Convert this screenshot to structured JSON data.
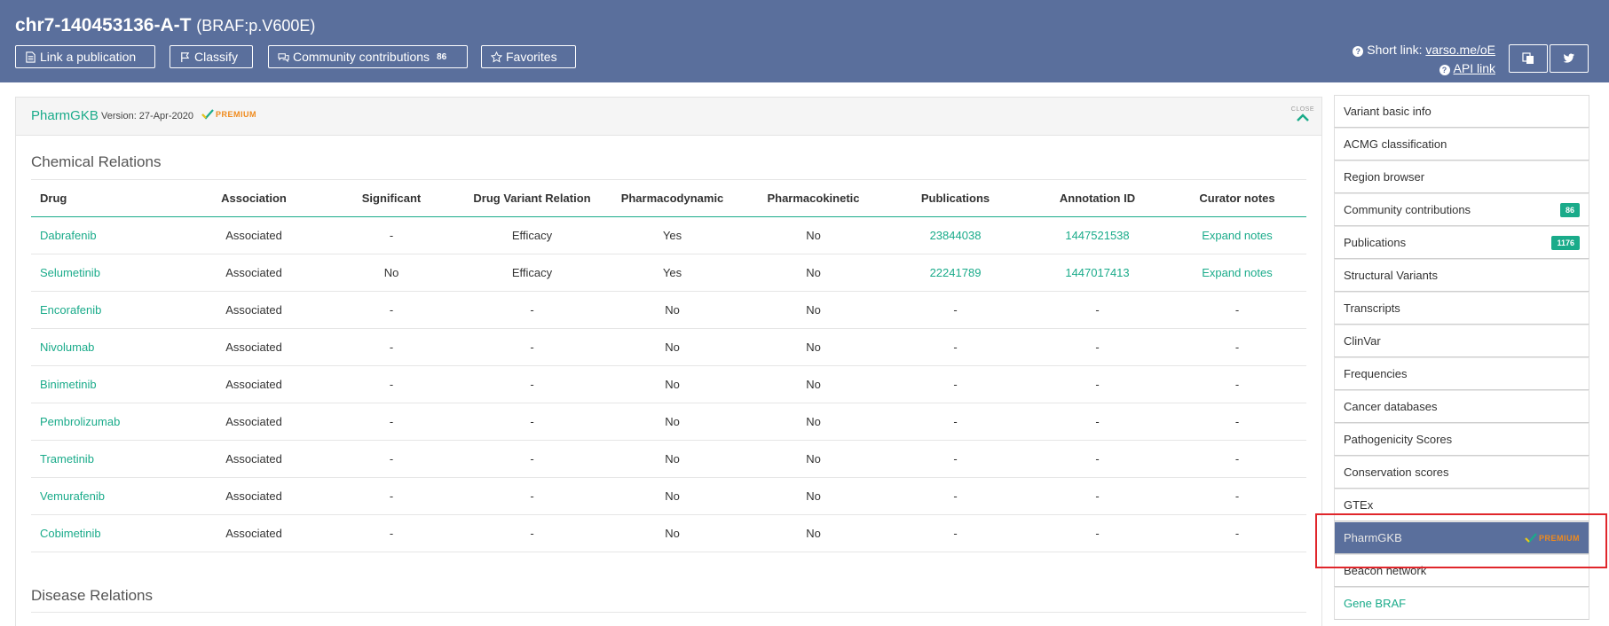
{
  "header": {
    "variant": "chr7-140453136-A-T",
    "protein": "(BRAF:p.V600E)",
    "buttons": {
      "link_publication": "Link a publication",
      "classify": "Classify",
      "community": "Community contributions",
      "community_count": "86",
      "favorites": "Favorites"
    },
    "short_link_label": "Short link:",
    "short_link_value": "varso.me/oE",
    "api_link": "API link",
    "icons": [
      "document-icon",
      "flag-icon",
      "comments-icon",
      "star-icon",
      "question-icon",
      "copy-icon",
      "twitter-icon"
    ]
  },
  "panel": {
    "title": "PharmGKB",
    "version": "Version: 27-Apr-2020",
    "premium": "PREMIUM",
    "close": "CLOSE",
    "chemical_relations_title": "Chemical Relations",
    "disease_relations_title": "Disease Relations",
    "columns": [
      "Drug",
      "Association",
      "Significant",
      "Drug Variant Relation",
      "Pharmacodynamic",
      "Pharmacokinetic",
      "Publications",
      "Annotation ID",
      "Curator notes"
    ],
    "rows": [
      [
        "Dabrafenib",
        "Associated",
        "-",
        "Efficacy",
        "Yes",
        "No",
        "23844038",
        "1447521538",
        "Expand notes"
      ],
      [
        "Selumetinib",
        "Associated",
        "No",
        "Efficacy",
        "Yes",
        "No",
        "22241789",
        "1447017413",
        "Expand notes"
      ],
      [
        "Encorafenib",
        "Associated",
        "-",
        "-",
        "No",
        "No",
        "-",
        "-",
        "-"
      ],
      [
        "Nivolumab",
        "Associated",
        "-",
        "-",
        "No",
        "No",
        "-",
        "-",
        "-"
      ],
      [
        "Binimetinib",
        "Associated",
        "-",
        "-",
        "No",
        "No",
        "-",
        "-",
        "-"
      ],
      [
        "Pembrolizumab",
        "Associated",
        "-",
        "-",
        "No",
        "No",
        "-",
        "-",
        "-"
      ],
      [
        "Trametinib",
        "Associated",
        "-",
        "-",
        "No",
        "No",
        "-",
        "-",
        "-"
      ],
      [
        "Vemurafenib",
        "Associated",
        "-",
        "-",
        "No",
        "No",
        "-",
        "-",
        "-"
      ],
      [
        "Cobimetinib",
        "Associated",
        "-",
        "-",
        "No",
        "No",
        "-",
        "-",
        "-"
      ]
    ]
  },
  "sidebar": {
    "items": [
      {
        "label": "Variant basic info",
        "badge": ""
      },
      {
        "label": "ACMG classification",
        "badge": ""
      },
      {
        "label": "Region browser",
        "badge": ""
      },
      {
        "label": "Community contributions",
        "badge": "86"
      },
      {
        "label": "Publications",
        "badge": "1176"
      },
      {
        "label": "Structural Variants",
        "badge": ""
      },
      {
        "label": "Transcripts",
        "badge": ""
      },
      {
        "label": "ClinVar",
        "badge": ""
      },
      {
        "label": "Frequencies",
        "badge": ""
      },
      {
        "label": "Cancer databases",
        "badge": ""
      },
      {
        "label": "Pathogenicity Scores",
        "badge": ""
      },
      {
        "label": "Conservation scores",
        "badge": ""
      },
      {
        "label": "GTEx",
        "badge": ""
      },
      {
        "label": "PharmGKB",
        "badge": "PREMIUM"
      },
      {
        "label": "Beacon network",
        "badge": ""
      },
      {
        "label": "Gene BRAF",
        "badge": ""
      }
    ]
  },
  "colors": {
    "header_bg": "#5a6f9c",
    "accent_green": "#1aab8a",
    "premium_orange": "#f08a1c",
    "highlight_red": "#e0262b"
  }
}
